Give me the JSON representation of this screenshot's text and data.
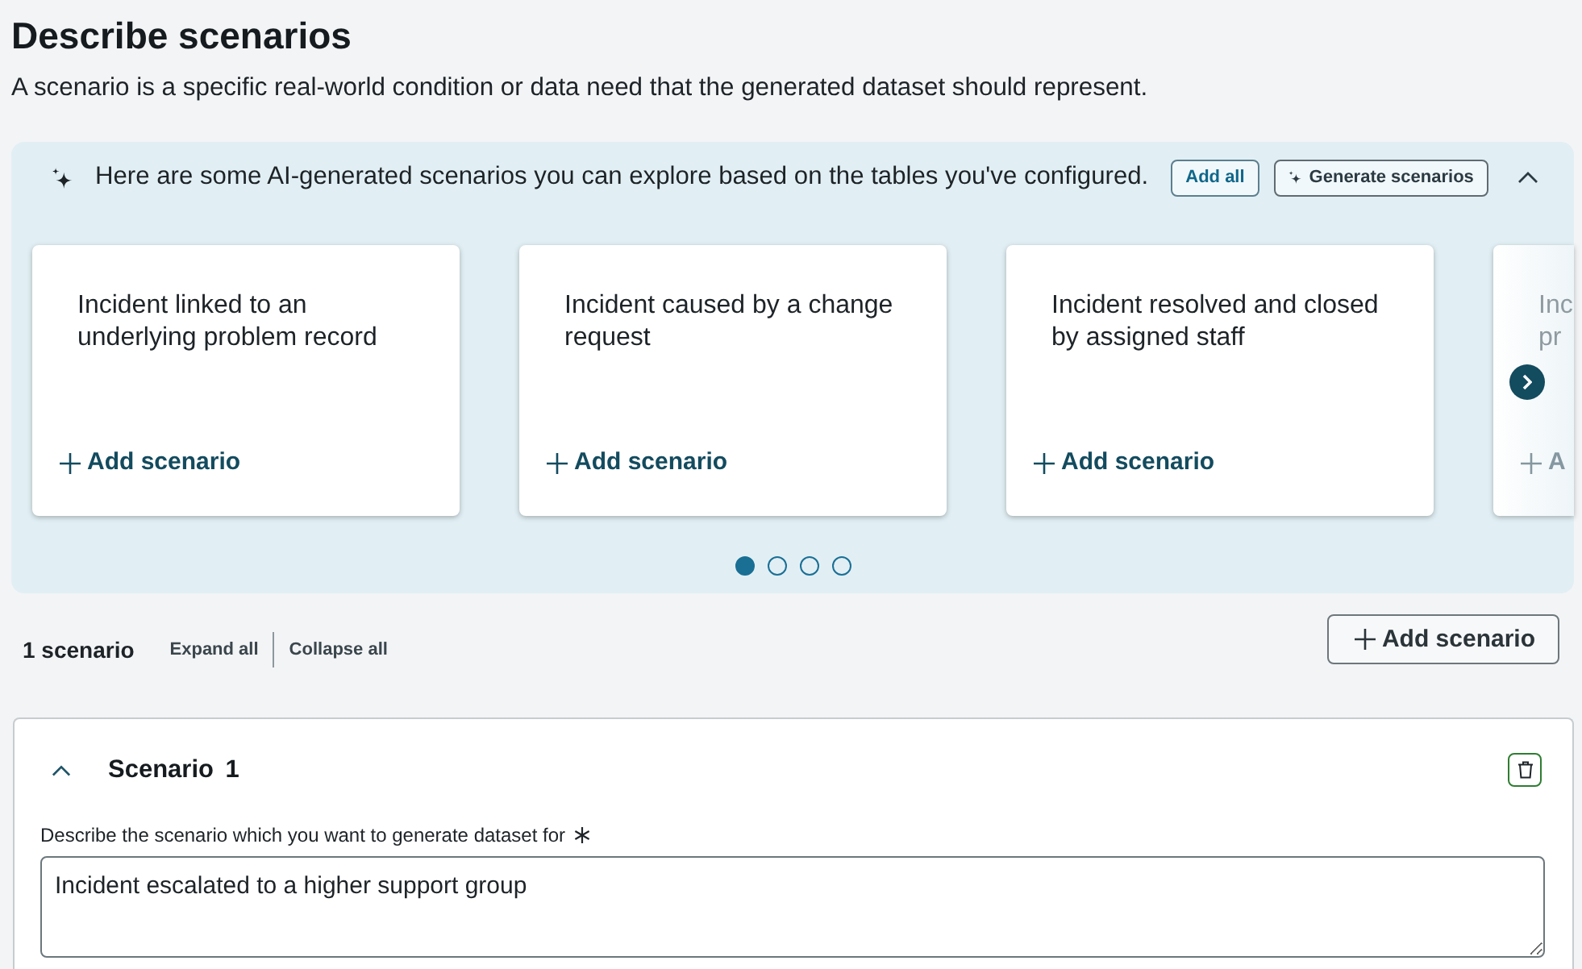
{
  "page": {
    "title": "Describe scenarios",
    "description": "A scenario is a specific real-world condition or data need that the generated dataset should represent."
  },
  "suggestions": {
    "message": "Here are some AI-generated scenarios you can explore based on the tables you've configured.",
    "expanded": true,
    "actions": [
      {
        "kind": "add_all",
        "label": "Add all"
      },
      {
        "kind": "generate",
        "label": "Generate scenarios"
      }
    ],
    "cards": [
      {
        "kind": "full",
        "text": "Incident linked to an underlying problem record",
        "action": "Add scenario"
      },
      {
        "kind": "full",
        "text": "Incident caused by a change request",
        "action": "Add scenario"
      },
      {
        "kind": "full",
        "text": "Incident resolved and closed by assigned staff",
        "action": "Add scenario"
      },
      {
        "kind": "partial",
        "lines": [
          "Inc",
          "pr"
        ],
        "action": "A"
      }
    ],
    "pagination": [
      {
        "selected": true
      },
      {
        "selected": false
      },
      {
        "selected": false
      },
      {
        "selected": false
      }
    ]
  },
  "scenarios": {
    "count": "1 scenario",
    "expand_all": "Expand all",
    "collapse_all": "Collapse all",
    "add_button": "Add scenario",
    "items": [
      {
        "title": "Scenario 1",
        "expanded": true,
        "delete_focused": true,
        "field_label": "Describe the scenario which you want to generate dataset for",
        "required": true,
        "value": "Incident escalated to a higher support group"
      }
    ]
  }
}
